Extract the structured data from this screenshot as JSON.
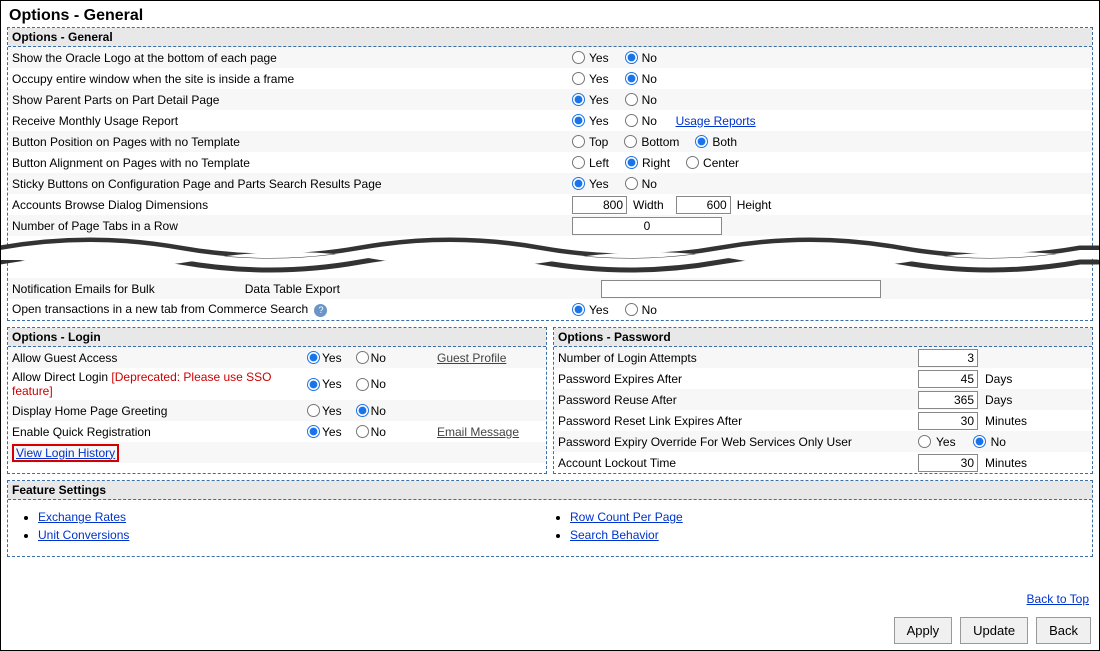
{
  "page": {
    "title": "Options - General"
  },
  "labels": {
    "yes": "Yes",
    "no": "No",
    "top": "Top",
    "bottom": "Bottom",
    "both": "Both",
    "left": "Left",
    "right": "Right",
    "center": "Center",
    "width": "Width",
    "height": "Height",
    "days": "Days",
    "minutes": "Minutes"
  },
  "general": {
    "heading": "Options - General",
    "rows": {
      "show_logo": {
        "label": "Show the Oracle Logo at the bottom of each page",
        "value": "No"
      },
      "occupy_window": {
        "label": "Occupy entire window when the site is inside a frame",
        "value": "No"
      },
      "show_parent_parts": {
        "label": "Show Parent Parts on Part Detail Page",
        "value": "Yes"
      },
      "monthly_usage": {
        "label": "Receive Monthly Usage Report",
        "value": "Yes",
        "link_label": "Usage Reports"
      },
      "button_position": {
        "label": "Button Position on Pages with no Template",
        "value": "Both"
      },
      "button_alignment": {
        "label": "Button Alignment on Pages with no Template",
        "value": "Right"
      },
      "sticky_buttons": {
        "label": "Sticky Buttons on Configuration Page and Parts Search Results Page",
        "value": "Yes"
      },
      "browse_dims": {
        "label": "Accounts Browse Dialog Dimensions",
        "width": "800",
        "height": "600"
      },
      "page_tabs": {
        "label": "Number of Page Tabs in a Row",
        "value": "0"
      },
      "bulk_export": {
        "label_prefix": "Notification Emails for Bulk ",
        "label_suffix": "Data Table Export"
      },
      "open_new_tab": {
        "label": "Open transactions in a new tab from Commerce Search",
        "value": "Yes"
      }
    }
  },
  "login": {
    "heading": "Options - Login",
    "rows": {
      "guest_access": {
        "label": "Allow Guest Access",
        "value": "Yes",
        "link_label": "Guest Profile"
      },
      "direct_login": {
        "label": "Allow Direct Login",
        "deprecated": "[Deprecated: Please use SSO feature]",
        "value": "Yes"
      },
      "home_greeting": {
        "label": "Display Home Page Greeting",
        "value": "No"
      },
      "quick_reg": {
        "label": "Enable Quick Registration",
        "value": "Yes",
        "link_label": "Email Message"
      },
      "view_history": {
        "label": "View Login History"
      }
    }
  },
  "password": {
    "heading": "Options - Password",
    "rows": {
      "attempts": {
        "label": "Number of Login Attempts",
        "value": "3"
      },
      "expires_after": {
        "label": "Password Expires After",
        "value": "45",
        "unit": "Days"
      },
      "reuse_after": {
        "label": "Password Reuse After",
        "value": "365",
        "unit": "Days"
      },
      "reset_link": {
        "label": "Password Reset Link Expires After",
        "value": "30",
        "unit": "Minutes"
      },
      "ws_override": {
        "label": "Password Expiry Override For Web Services Only User",
        "value": "No"
      },
      "lockout": {
        "label": "Account Lockout Time",
        "value": "30",
        "unit": "Minutes"
      }
    }
  },
  "features": {
    "heading": "Feature Settings",
    "col1": [
      "Exchange Rates",
      "Unit Conversions"
    ],
    "col2": [
      "Row Count Per Page",
      "Search Behavior"
    ]
  },
  "footer": {
    "back_to_top": "Back to Top",
    "apply": "Apply",
    "update": "Update",
    "back": "Back"
  }
}
